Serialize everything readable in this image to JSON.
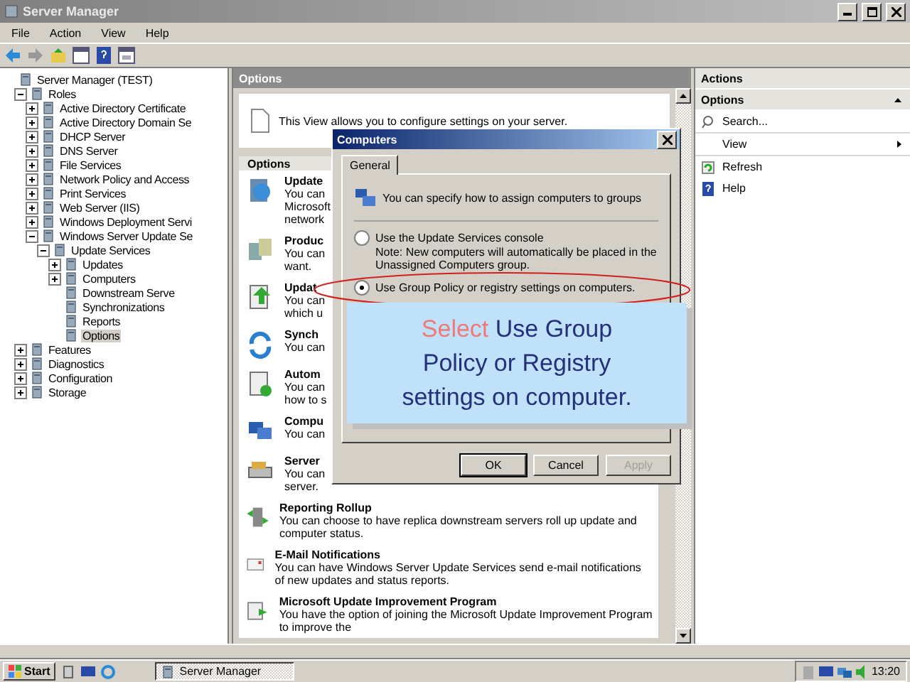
{
  "window": {
    "title": "Server Manager"
  },
  "menu": [
    "File",
    "Action",
    "View",
    "Help"
  ],
  "tree": [
    {
      "label": "Server Manager (TEST)",
      "selected": false,
      "children": [
        {
          "label": "Roles",
          "expanded": true,
          "selected": false,
          "children": [
            {
              "label": "Active Directory Certificate",
              "expanded": false,
              "selected": false
            },
            {
              "label": "Active Directory Domain Se",
              "expanded": false,
              "selected": false
            },
            {
              "label": "DHCP Server",
              "expanded": false,
              "selected": false
            },
            {
              "label": "DNS Server",
              "expanded": false,
              "selected": false
            },
            {
              "label": "File Services",
              "expanded": false,
              "selected": false
            },
            {
              "label": "Network Policy and Access",
              "expanded": false,
              "selected": false
            },
            {
              "label": "Print Services",
              "expanded": false,
              "selected": false
            },
            {
              "label": "Web Server (IIS)",
              "expanded": false,
              "selected": false
            },
            {
              "label": "Windows Deployment Servi",
              "expanded": false,
              "selected": false
            },
            {
              "label": "Windows Server Update Se",
              "expanded": true,
              "selected": false,
              "children": [
                {
                  "label": "Update Services",
                  "expanded": true,
                  "selected": false,
                  "children": [
                    {
                      "label": "Updates",
                      "expanded": false,
                      "selected": false
                    },
                    {
                      "label": "Computers",
                      "expanded": false,
                      "selected": false
                    },
                    {
                      "label": "Downstream Serve",
                      "selected": false
                    },
                    {
                      "label": "Synchronizations",
                      "selected": false
                    },
                    {
                      "label": "Reports",
                      "selected": false
                    },
                    {
                      "label": "Options",
                      "selected": true
                    }
                  ]
                }
              ]
            }
          ]
        },
        {
          "label": "Features",
          "expanded": false,
          "selected": false
        },
        {
          "label": "Diagnostics",
          "expanded": false,
          "selected": false
        },
        {
          "label": "Configuration",
          "expanded": false,
          "selected": false
        },
        {
          "label": "Storage",
          "expanded": false,
          "selected": false
        }
      ]
    }
  ],
  "center": {
    "title": "Options",
    "description": "This View allows you to configure settings on your server.",
    "section": "Options",
    "items": [
      {
        "title": "Update",
        "lines": [
          "You can",
          "Microsoft",
          "network"
        ]
      },
      {
        "title": "Produc",
        "lines": [
          "You can",
          "want."
        ]
      },
      {
        "title": "Updat",
        "lines": [
          "You can",
          "which u"
        ]
      },
      {
        "title": "Synch",
        "lines": [
          "You can"
        ]
      },
      {
        "title": "Autom",
        "lines": [
          "You can",
          "how to s"
        ]
      },
      {
        "title": "Compu",
        "lines": [
          "You can"
        ]
      },
      {
        "title": "Server",
        "lines": [
          "You can",
          "server."
        ]
      },
      {
        "title": "Reporting Rollup",
        "lines": [
          "You can choose to have replica downstream servers roll up update and computer status."
        ]
      },
      {
        "title": "E-Mail Notifications",
        "lines": [
          "You can have Windows Server Update Services send e-mail notifications of new updates and status reports."
        ]
      },
      {
        "title": "Microsoft Update Improvement Program",
        "lines": [
          "You have the option of joining the Microsoft Update Improvement Program to improve the"
        ]
      }
    ]
  },
  "dialog": {
    "title": "Computers",
    "tabs": [
      {
        "label": "General",
        "selected": true
      }
    ],
    "header": "You can specify how to assign computers to groups",
    "options": [
      {
        "label": "Use the Update Services console",
        "note": "Note: New computers will automatically be placed in the Unassigned Computers group.",
        "selected": false
      },
      {
        "label": "Use Group Policy or registry settings on computers.",
        "selected": true
      }
    ],
    "buttons": [
      {
        "label": "OK",
        "default": true,
        "disabled": false
      },
      {
        "label": "Cancel",
        "default": false,
        "disabled": false
      },
      {
        "label": "Apply",
        "default": false,
        "disabled": true
      }
    ]
  },
  "callout": {
    "highlight": "Select",
    "text": "Use Group Policy or Registry settings on computer."
  },
  "actions": {
    "title": "Actions",
    "section": "Options",
    "items": [
      {
        "label": "Search...",
        "kind": "search"
      },
      {
        "label": "View",
        "kind": "submenu"
      },
      {
        "label": "Refresh",
        "kind": "refresh"
      },
      {
        "label": "Help",
        "kind": "help"
      }
    ]
  },
  "taskbar": {
    "start": "Start",
    "tasks": [
      {
        "label": "Server Manager",
        "selected": true
      }
    ],
    "clock": "13:20"
  }
}
